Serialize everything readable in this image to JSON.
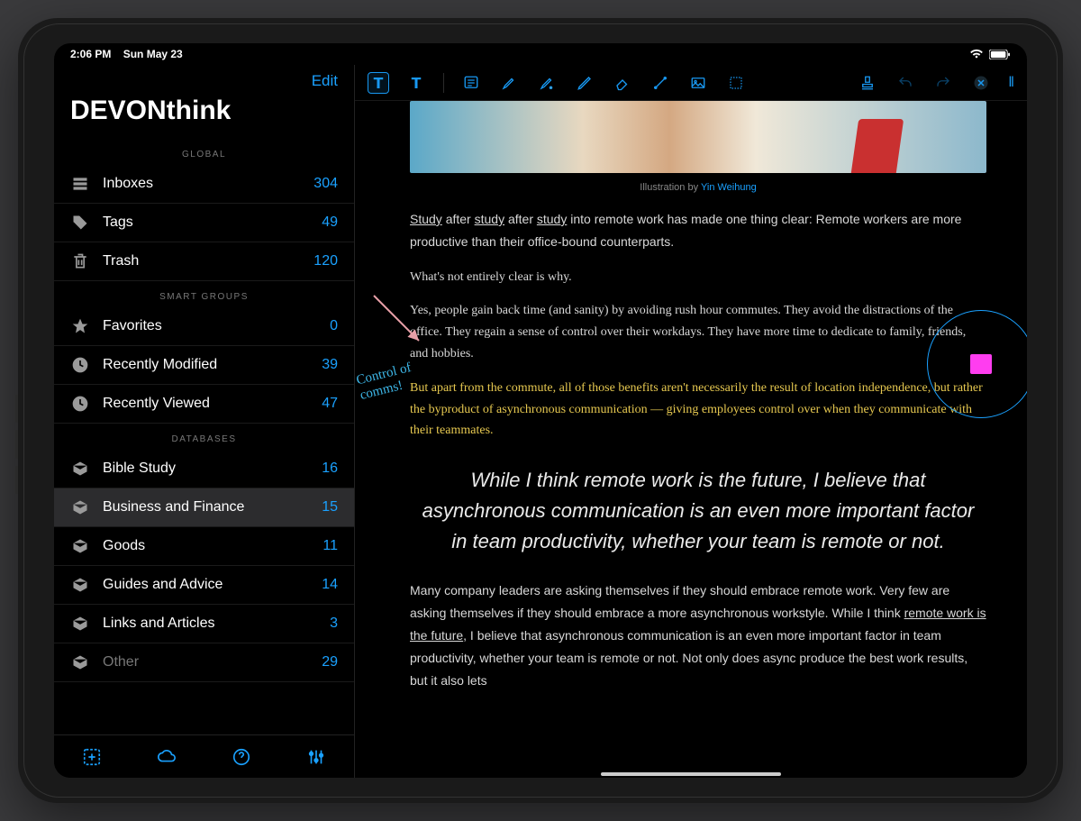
{
  "status": {
    "time": "2:06 PM",
    "date": "Sun May 23"
  },
  "sidebar": {
    "edit_label": "Edit",
    "app_title": "DEVONthink",
    "sections": {
      "global": {
        "header": "GLOBAL"
      },
      "smart": {
        "header": "SMART GROUPS"
      },
      "databases": {
        "header": "DATABASES"
      }
    },
    "global_items": [
      {
        "label": "Inboxes",
        "count": "304"
      },
      {
        "label": "Tags",
        "count": "49"
      },
      {
        "label": "Trash",
        "count": "120"
      }
    ],
    "smart_items": [
      {
        "label": "Favorites",
        "count": "0"
      },
      {
        "label": "Recently Modified",
        "count": "39"
      },
      {
        "label": "Recently Viewed",
        "count": "47"
      }
    ],
    "database_items": [
      {
        "label": "Bible Study",
        "count": "16"
      },
      {
        "label": "Business and Finance",
        "count": "15",
        "selected": true
      },
      {
        "label": "Goods",
        "count": "11"
      },
      {
        "label": "Guides and Advice",
        "count": "14"
      },
      {
        "label": "Links and Articles",
        "count": "3"
      },
      {
        "label": "Other",
        "count": "29"
      }
    ]
  },
  "document": {
    "caption_prefix": "Illustration by ",
    "caption_link": "Yin Weihung",
    "para1_a": "Study",
    "para1_b": " after ",
    "para1_c": "study",
    "para1_d": " after ",
    "para1_e": "study",
    "para1_f": " into remote work has made one thing clear: Remote workers are more productive than their office-bound counterparts.",
    "para2": "What's not entirely clear is why.",
    "para3": "Yes, people gain back time (and sanity) by avoiding rush hour commutes. They avoid the distractions of the office. They regain a sense of control over their workdays. They have more time to dedicate to family, friends, and hobbies.",
    "para_highlight": "But apart from the commute, all of those benefits aren't necessarily the result of location independence, but rather the byproduct of asynchronous communication — giving employees control over when they communicate with their teammates.",
    "pullquote": "While I think remote work is the future, I believe that asynchronous communication is an even more important factor in team productivity, whether your team is remote or not.",
    "para4_a": "Many company leaders are asking themselves if they should embrace remote work. Very few are asking themselves if they should embrace a more asynchronous workstyle. While I think ",
    "para4_link": "remote work is the future",
    "para4_b": ", I believe that asynchronous communication is an even more important factor in team productivity, whether your team is remote or not. Not only does async produce the best work results, but it also lets",
    "annotation_text": "Control of\ncomms!"
  },
  "colors": {
    "accent": "#1aa1ff",
    "highlight": "#e6c850",
    "annotation_ink": "#3db7e8",
    "sticky": "#ff3df0",
    "arrow": "#e8a0a8"
  }
}
